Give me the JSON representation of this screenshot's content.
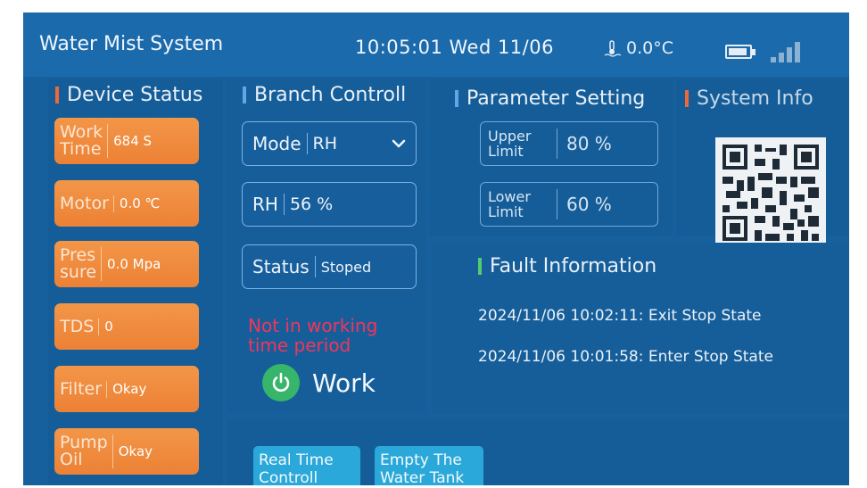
{
  "header": {
    "title": "Water Mist System",
    "datetime": "10:05:01 Wed 11/06",
    "temperature": "0.0°C"
  },
  "device_status": {
    "title": "Device Status",
    "items": [
      {
        "label": "Work Time",
        "label_l1": "Work",
        "label_l2": "Time",
        "value": "684 S"
      },
      {
        "label": "Motor",
        "value": "0.0 ℃"
      },
      {
        "label": "Pressure",
        "label_l1": "Pres",
        "label_l2": "sure",
        "value": "0.0 Mpa"
      },
      {
        "label": "TDS",
        "value": "0"
      },
      {
        "label": "Filter",
        "value": "Okay"
      },
      {
        "label": "Pump Oil",
        "label_l1": "Pump",
        "label_l2": "Oil",
        "value": "Okay"
      }
    ]
  },
  "branch_control": {
    "title": "Branch Controll",
    "mode_label": "Mode",
    "mode_value": "RH",
    "rh_label": "RH",
    "rh_value": "56 %",
    "status_label": "Status",
    "status_value": "Stoped",
    "warning": "Not in working time period",
    "work_label": "Work"
  },
  "parameter_setting": {
    "title": "Parameter Setting",
    "upper_label": "Upper Limit",
    "upper_value": "80 %",
    "lower_label": "Lower Limit",
    "lower_value": "60 %"
  },
  "system_info": {
    "title": "System Info"
  },
  "fault_information": {
    "title": "Fault Information",
    "entries": [
      "2024/11/06 10:02:11: Exit Stop State",
      "2024/11/06 10:01:58: Enter Stop State"
    ]
  },
  "bottom_buttons": {
    "realtime": "Real Time Controll",
    "empty_tank": "Empty The Water Tank"
  },
  "colors": {
    "screen_bg": "#17609e",
    "orange_tile": "#ef8a3c",
    "warning_red": "#f2355a",
    "power_green": "#37b56a",
    "button_cyan": "#2aa8d9"
  }
}
